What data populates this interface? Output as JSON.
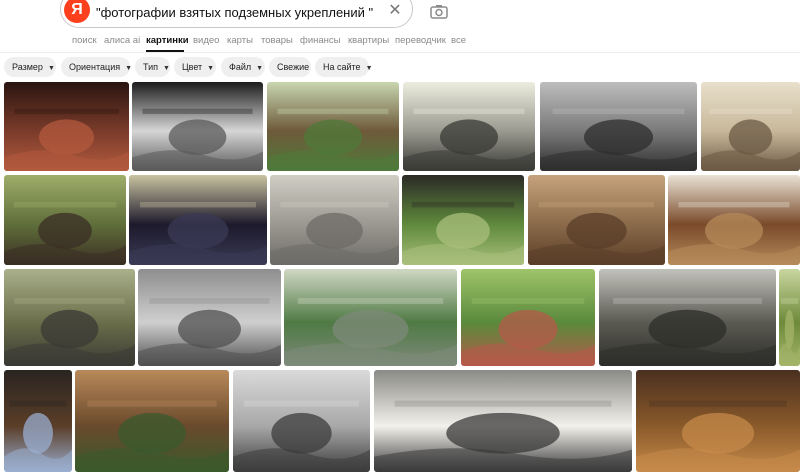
{
  "search": {
    "logo_letter": "Я",
    "query": "\"фотографии взятых подземных укреплений \""
  },
  "nav": {
    "items": [
      "поиск",
      "алиса ai",
      "картинки",
      "видео",
      "карты",
      "товары",
      "финансы",
      "квартиры",
      "переводчик",
      "все"
    ],
    "active_index": 2
  },
  "filters": [
    "Размер",
    "Ориентация",
    "Тип",
    "Цвет",
    "Файл",
    "Свежие",
    "На сайте"
  ],
  "results": {
    "rows": [
      [
        {
          "subject": "brick vaulted casemate interior",
          "colors": [
            "#7a3b2a",
            "#b35a3e",
            "#2a1510"
          ]
        },
        {
          "subject": "collapsed concrete bunker, black and white",
          "colors": [
            "#d6d6d6",
            "#5a5a5a",
            "#1c1c1c"
          ]
        },
        {
          "subject": "log-lined trench in forest",
          "colors": [
            "#6e5a3a",
            "#4f7a3a",
            "#c8d6b0"
          ]
        },
        {
          "subject": "timbered bunker entrance, sepia",
          "colors": [
            "#9a9a90",
            "#3a3a36",
            "#ededdf"
          ]
        },
        {
          "subject": "earth covered dugout, black and white",
          "colors": [
            "#7a7a7a",
            "#2e2e2e",
            "#bdbdbd"
          ]
        },
        {
          "subject": "period engraving of soldiers in trench",
          "colors": [
            "#c8b89a",
            "#6b5a44",
            "#e8e0cc"
          ]
        }
      ],
      [
        {
          "subject": "mossy ruined bunker",
          "colors": [
            "#5f6e3a",
            "#3a2e24",
            "#9fae6a"
          ]
        },
        {
          "subject": "dark tunnel with light",
          "colors": [
            "#1d1a2c",
            "#3b3a55",
            "#c9c3a0"
          ]
        },
        {
          "subject": "concrete arched corridor",
          "colors": [
            "#9a9890",
            "#6d6b66",
            "#cfcdc4"
          ]
        },
        {
          "subject": "grass covered pillbox in field",
          "colors": [
            "#5f8a3c",
            "#a9bf7c",
            "#2a2a26"
          ]
        },
        {
          "subject": "timber lined underground passage",
          "colors": [
            "#8a6a4a",
            "#5a3e28",
            "#c6a37c"
          ]
        },
        {
          "subject": "reconstructed log trench",
          "colors": [
            "#7a4a2a",
            "#b68a5a",
            "#e9e2d5"
          ]
        }
      ],
      [
        {
          "subject": "concrete bunker in forest",
          "colors": [
            "#6b6e4a",
            "#3a3a34",
            "#a9b08a"
          ]
        },
        {
          "subject": "soldiers digging trench, historic photo",
          "colors": [
            "#cfcfcf",
            "#505050",
            "#8e8e8e"
          ]
        },
        {
          "subject": "restored blockhouse in birch forest",
          "colors": [
            "#4f7a44",
            "#7e8a7a",
            "#d0d8c4"
          ]
        },
        {
          "subject": "ring foundation in meadow",
          "colors": [
            "#5a8a3c",
            "#b65a4a",
            "#9fc46a"
          ]
        },
        {
          "subject": "massive concrete casemate",
          "colors": [
            "#5a5a52",
            "#2e2e2a",
            "#c2c2bc"
          ]
        },
        {
          "subject": "grass edge",
          "colors": [
            "#6e8a3a",
            "#a4b46a",
            "#c9d6a0"
          ]
        }
      ],
      [
        {
          "subject": "soldier in tunnel mouth",
          "colors": [
            "#5a3e28",
            "#9aaed0",
            "#2a2420"
          ]
        },
        {
          "subject": "dugout entrance with log walls",
          "colors": [
            "#6a4a2c",
            "#3a5a2c",
            "#b8895a"
          ]
        },
        {
          "subject": "ruined fortification, black and white",
          "colors": [
            "#a8a8a8",
            "#3c3c3c",
            "#dadada"
          ]
        },
        {
          "subject": "hand drawn cutaway diagram of trench",
          "colors": [
            "#f3f1ec",
            "#3a3a3a",
            "#8a8a86"
          ]
        },
        {
          "subject": "timber framed dugout excavation",
          "colors": [
            "#8a5a2a",
            "#c68a4a",
            "#4a3020"
          ]
        }
      ]
    ]
  }
}
